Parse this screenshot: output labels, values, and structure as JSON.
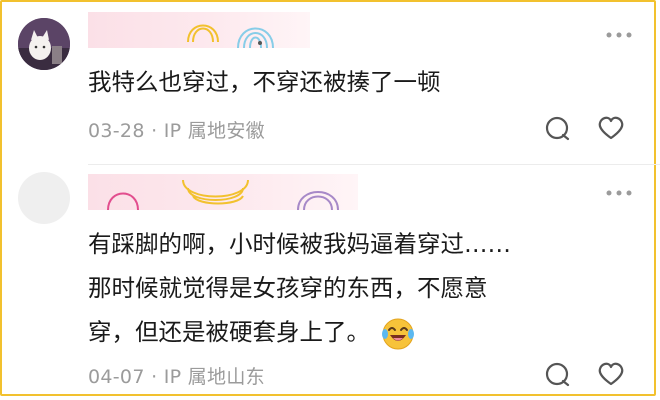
{
  "comments": [
    {
      "text_lines": [
        "我特么也穿过，不穿还被揍了一顿"
      ],
      "date": "03-28",
      "sep": "·",
      "location": "IP 属地安徽"
    },
    {
      "text_lines": [
        "有踩脚的啊，小时候被我妈逼着穿过……",
        "那时候就觉得是女孩穿的东西，不愿意",
        "穿，但还是被硬套身上了。"
      ],
      "date": "04-07",
      "sep": "·",
      "location": "IP 属地山东"
    }
  ],
  "icons": {
    "more": "more-icon",
    "comment": "comment-bubble-icon",
    "like": "heart-icon",
    "emoji": "laughing-crying-emoji-icon"
  },
  "colors": {
    "border": "#f2c12e",
    "meta": "#9b9b9b",
    "text": "#1a1a1a"
  }
}
